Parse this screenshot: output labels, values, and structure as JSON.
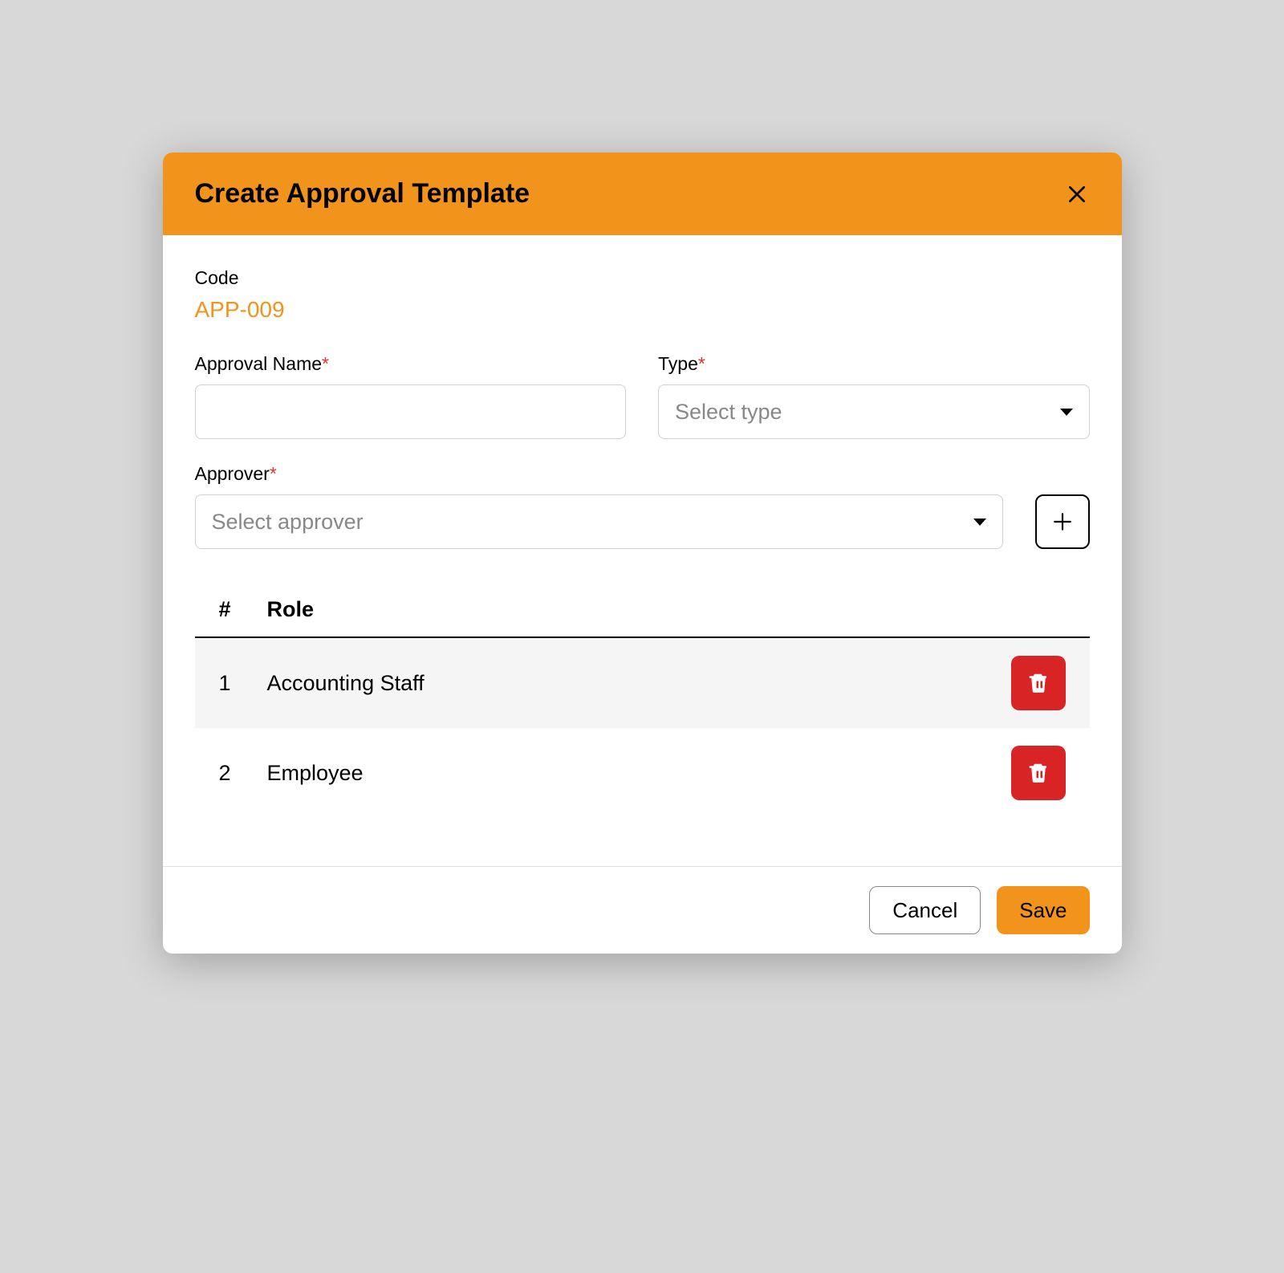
{
  "header": {
    "title": "Create Approval Template"
  },
  "form": {
    "code_label": "Code",
    "code_value": "APP-009",
    "approval_name_label": "Approval Name",
    "approval_name_value": "",
    "type_label": "Type",
    "type_placeholder": "Select type",
    "approver_label": "Approver",
    "approver_placeholder": "Select approver"
  },
  "table": {
    "headers": {
      "num": "#",
      "role": "Role"
    },
    "rows": [
      {
        "num": "1",
        "role": "Accounting Staff"
      },
      {
        "num": "2",
        "role": "Employee"
      }
    ]
  },
  "footer": {
    "cancel": "Cancel",
    "save": "Save"
  }
}
